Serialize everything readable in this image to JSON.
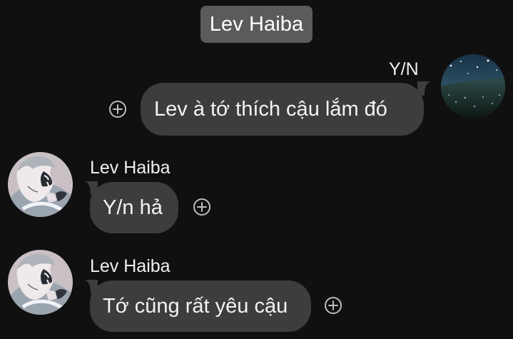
{
  "conversation": {
    "title": "Lev Haiba"
  },
  "messages": [
    {
      "sender": "Y/N",
      "text": "Lev à tớ thích cậu lắm đó",
      "side": "right"
    },
    {
      "sender": "Lev Haiba",
      "text": "Y/n hả",
      "side": "left"
    },
    {
      "sender": "Lev Haiba",
      "text": "Tớ cũng rất yêu cậu",
      "side": "left"
    }
  ],
  "icons": {
    "reaction": "plus-circle-icon",
    "user_avatar": "starry-field-avatar",
    "contact_avatar": "anime-character-avatar"
  },
  "colors": {
    "background": "#101010",
    "bubble": "#3d3d3d",
    "header_pill": "#5b5b5b",
    "text": "#f1f1f1"
  }
}
